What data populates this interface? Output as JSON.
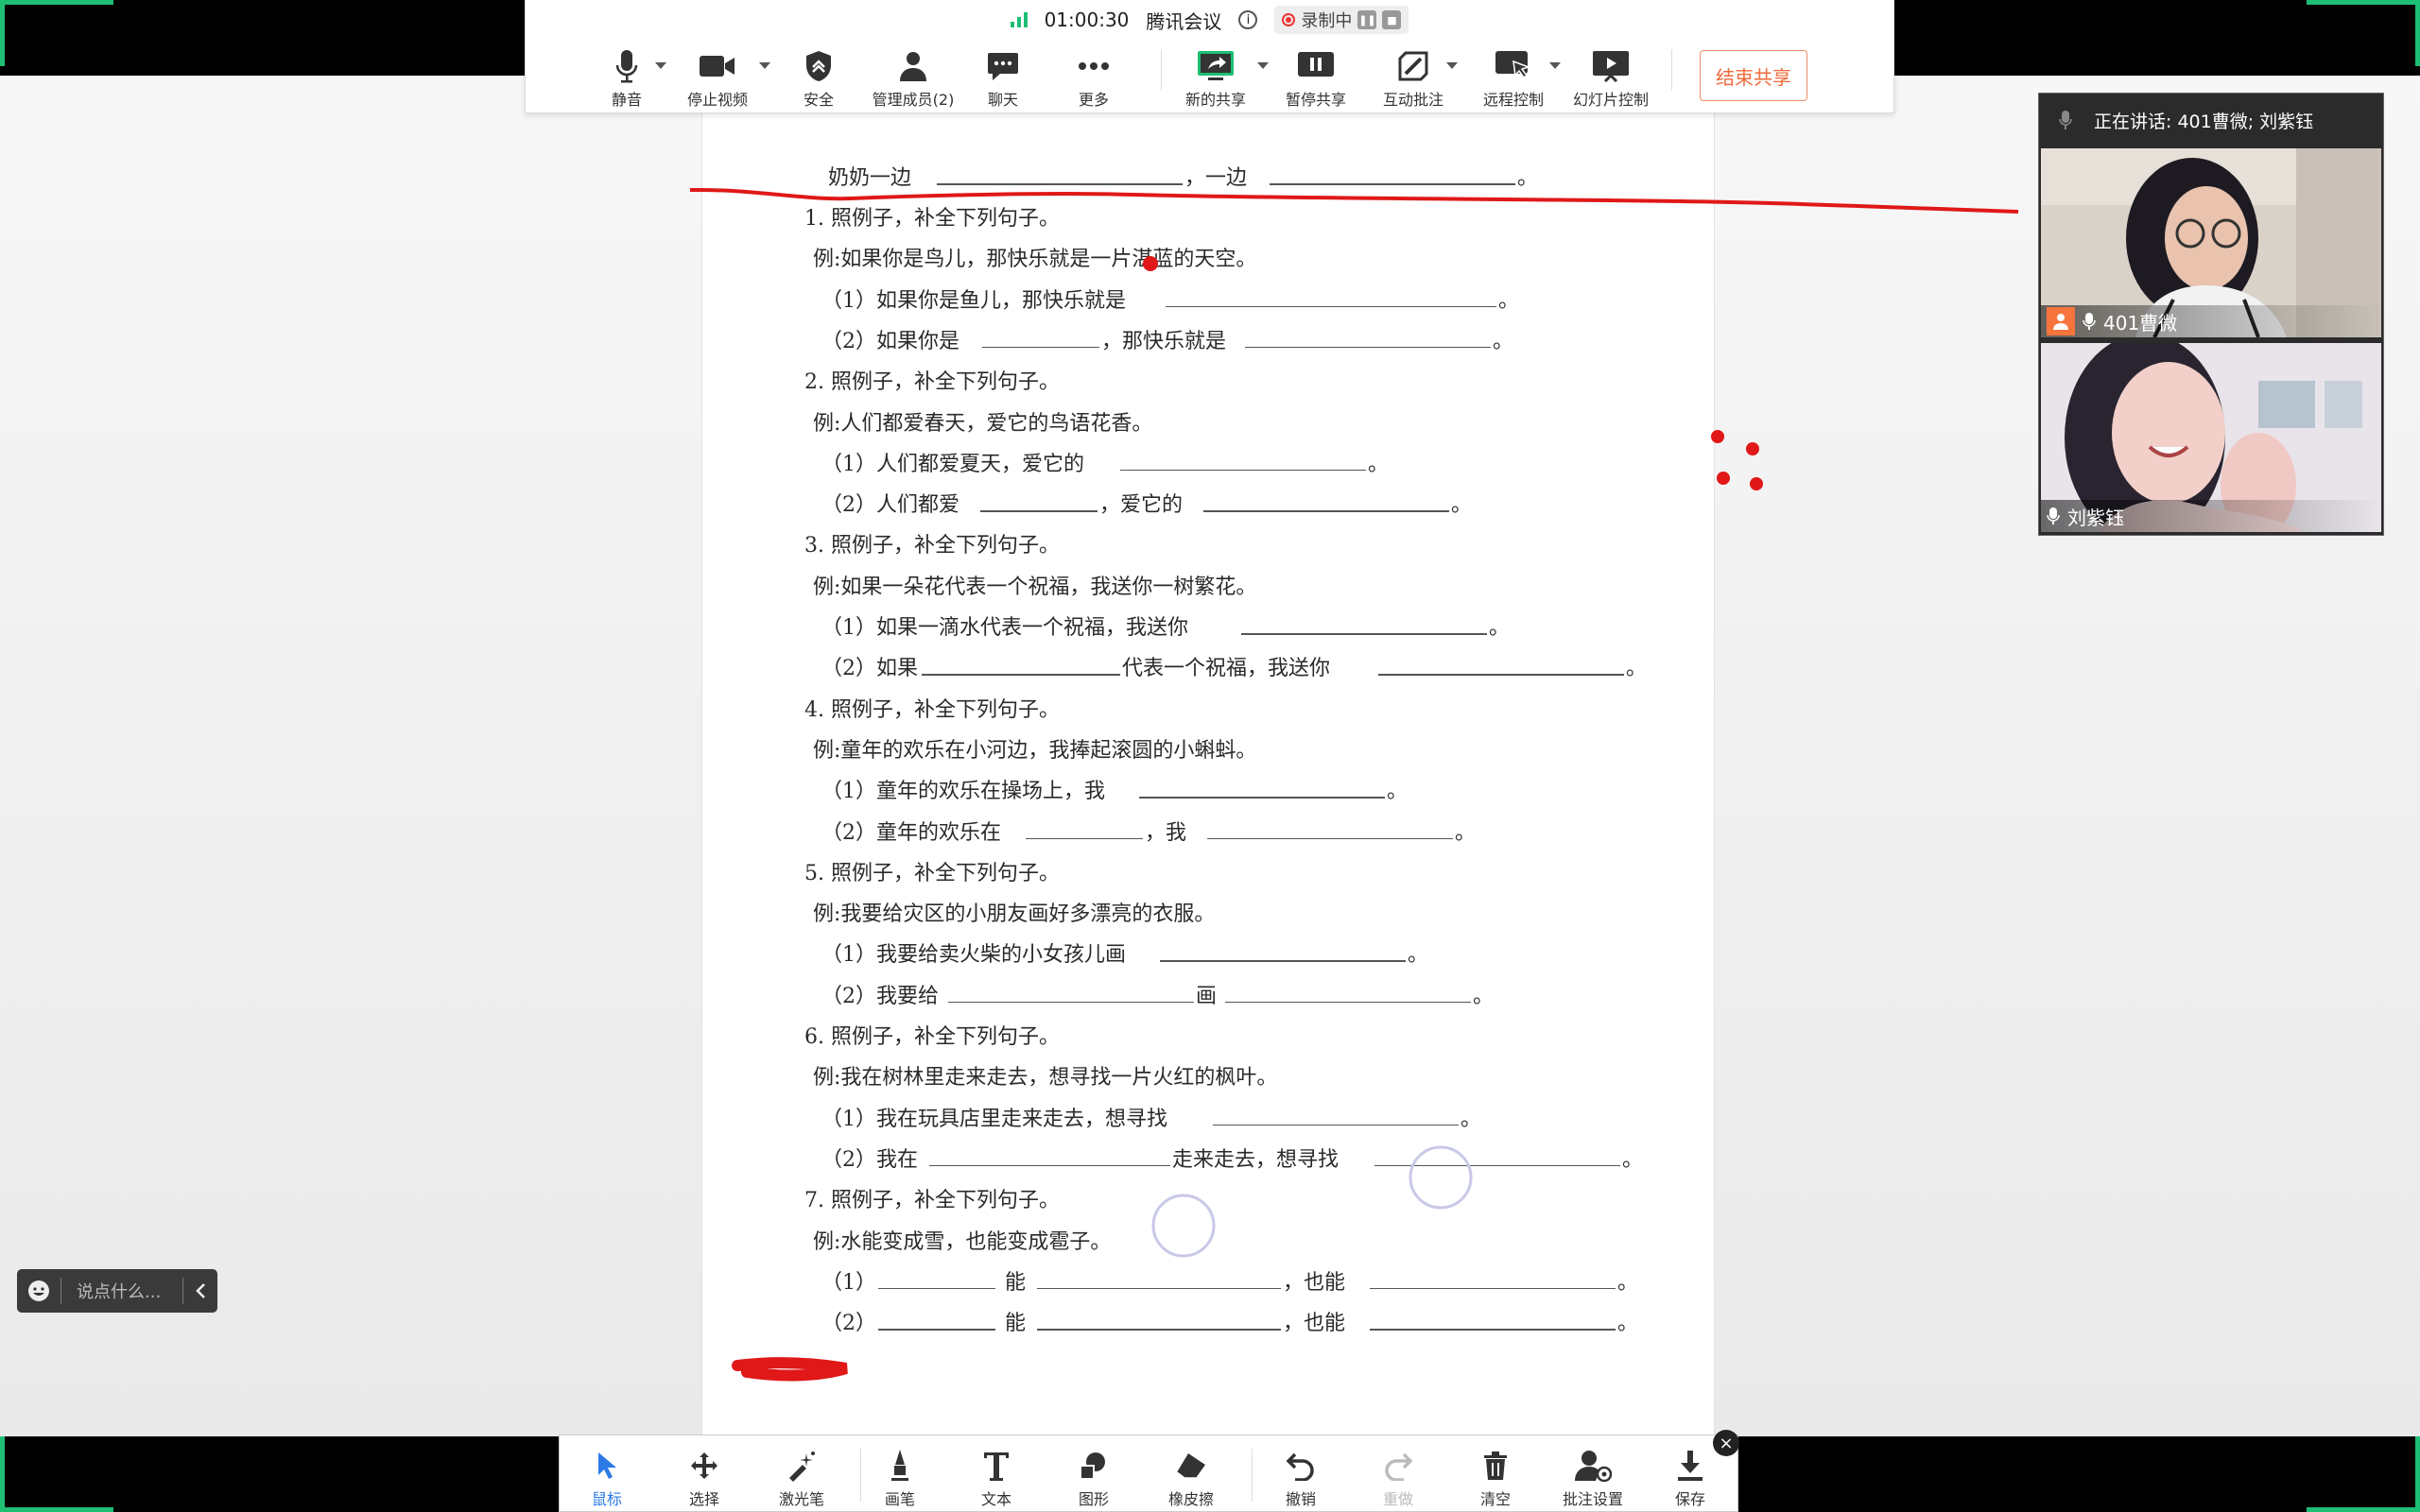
{
  "meeting": {
    "elapsed": "01:00:30",
    "app_name": "腾讯会议",
    "info_icon": "info-icon",
    "recording_label": "录制中",
    "end_share_label": "结束共享"
  },
  "toolbar": {
    "mute": "静音",
    "stop_video": "停止视频",
    "security": "安全",
    "members": "管理成员(2)",
    "chat": "聊天",
    "more": "更多",
    "new_share": "新的共享",
    "pause_share": "暂停共享",
    "annotate": "互动批注",
    "remote_control": "远程控制",
    "slideshow": "幻灯片控制"
  },
  "video_panel": {
    "speaking_label": "正在讲话: 401曹微; 刘紫钰",
    "participants": [
      {
        "name": "401曹微"
      },
      {
        "name": "刘紫钰"
      }
    ]
  },
  "document": {
    "top_line": {
      "a": "奶奶一边",
      "b": "，一边",
      "c": "。"
    },
    "sections": [
      {
        "title": "1. 照例子，补全下列句子。",
        "example": "例:如果你是鸟儿，那快乐就是一片湛蓝的天空。",
        "q1": "（1）如果你是鱼儿，那快乐就是",
        "q2a": "（2）如果你是",
        "q2b": "，那快乐就是"
      },
      {
        "title": "2. 照例子，补全下列句子。",
        "example": "例:人们都爱春天，爱它的鸟语花香。",
        "q1": "（1）人们都爱夏天，爱它的",
        "q2a": "（2）人们都爱",
        "q2b": "，爱它的"
      },
      {
        "title": "3. 照例子，补全下列句子。",
        "example": "例:如果一朵花代表一个祝福，我送你一树繁花。",
        "q1": "（1）如果一滴水代表一个祝福，我送你",
        "q2a": "（2）如果",
        "q2b": "代表一个祝福，我送你"
      },
      {
        "title": "4. 照例子，补全下列句子。",
        "example": "例:童年的欢乐在小河边，我捧起滚圆的小蝌蚪。",
        "q1": "（1）童年的欢乐在操场上，我",
        "q2a": "（2）童年的欢乐在",
        "q2b": "，我"
      },
      {
        "title": "5. 照例子，补全下列句子。",
        "example": "例:我要给灾区的小朋友画好多漂亮的衣服。",
        "q1": "（1）我要给卖火柴的小女孩儿画",
        "q2a": "（2）我要给",
        "q2b": "画"
      },
      {
        "title": "6. 照例子，补全下列句子。",
        "example": "例:我在树林里走来走去，想寻找一片火红的枫叶。",
        "q1": "（1）我在玩具店里走来走去，想寻找",
        "q2a": "（2）我在",
        "q2b": "走来走去，想寻找"
      },
      {
        "title": "7. 照例子，补全下列句子。",
        "example": "例:水能变成雪，也能变成雹子。",
        "q1": "（1）",
        "q1b": "能",
        "q1c": "，也能",
        "q2a": "（2）",
        "q2b": "能",
        "q2c": "，也能"
      }
    ],
    "period": "。"
  },
  "chat_input": {
    "placeholder": "说点什么..."
  },
  "annotation_toolbar": {
    "mouse": "鼠标",
    "select": "选择",
    "laser": "激光笔",
    "pen": "画笔",
    "text": "文本",
    "shape": "图形",
    "eraser": "橡皮擦",
    "undo": "撤销",
    "redo": "重做",
    "clear": "清空",
    "settings": "批注设置",
    "save": "保存"
  },
  "colors": {
    "accent_green": "#1dbf73",
    "annotation_red": "#e01818",
    "end_share": "#f06a3a",
    "active_blue": "#2c7be5"
  }
}
